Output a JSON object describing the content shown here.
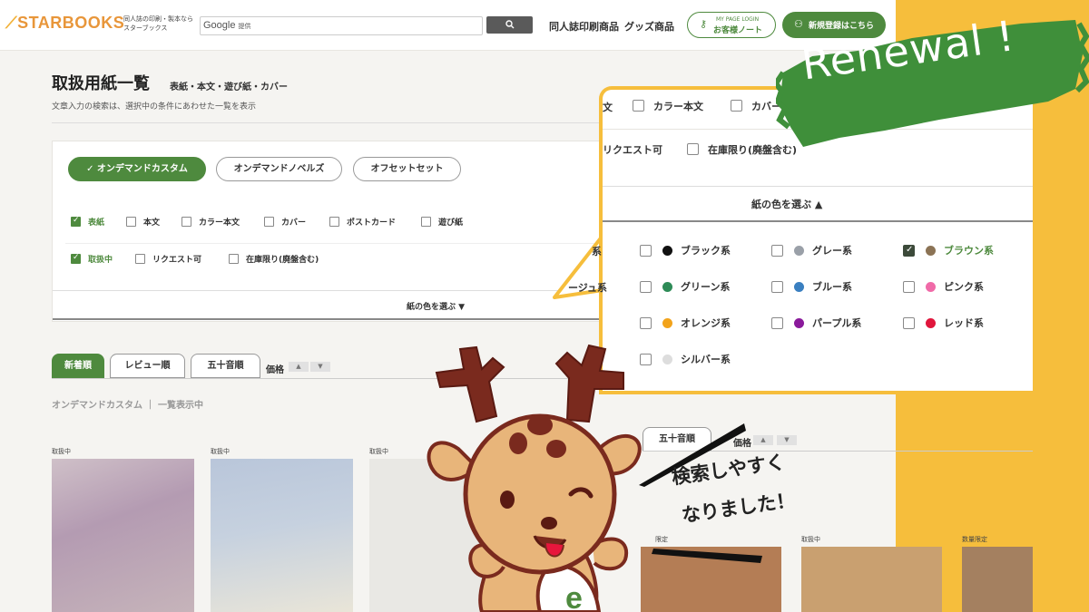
{
  "header": {
    "logo": "STARBOOKS",
    "logo_sub": "同人誌の印刷・製本なら スターブックス",
    "search_placeholder": "Google 提供",
    "search_prefix": "Google",
    "search_suffix": "提供",
    "nav": [
      "同人誌印刷商品",
      "グッズ商品"
    ],
    "mypage_small": "MY PAGE LOGIN",
    "mypage_label": "お客様ノート",
    "signup_label": "新規登録はこちら"
  },
  "page": {
    "title": "取扱用紙一覧",
    "subtitle": "表紙・本文・遊び紙・カバー",
    "description": "文章入力の検索は、選択中の条件にあわせた一覧を表示"
  },
  "filters": {
    "products": [
      {
        "label": "✓ オンデマンドカスタム",
        "active": true
      },
      {
        "label": "オンデマンドノベルズ",
        "active": false
      },
      {
        "label": "オフセットセット",
        "active": false
      }
    ],
    "usage": [
      {
        "label": "表紙",
        "checked": true
      },
      {
        "label": "本文",
        "checked": false
      },
      {
        "label": "カラー本文",
        "checked": false
      },
      {
        "label": "カバー",
        "checked": false
      },
      {
        "label": "ポストカード",
        "checked": false
      },
      {
        "label": "遊び紙",
        "checked": false
      }
    ],
    "status": [
      {
        "label": "取扱中",
        "checked": true
      },
      {
        "label": "リクエスト可",
        "checked": false
      },
      {
        "label": "在庫限り(廃盤含む)",
        "checked": false
      }
    ],
    "color_bar_label": "紙の色を選ぶ ▼"
  },
  "sort": {
    "tabs": [
      {
        "label": "新着順",
        "active": true
      },
      {
        "label": "レビュー順",
        "active": false
      },
      {
        "label": "五十音順",
        "active": false
      }
    ],
    "price_label": "価格",
    "price_up": "▲",
    "price_down": "▼"
  },
  "breadcrumb": "オンデマンドカスタム ｜ 一覧表示中",
  "papers": [
    {
      "status": "取扱中"
    },
    {
      "status": "取扱中"
    },
    {
      "status": "取扱中"
    }
  ],
  "zoom": {
    "row1_partial": "文",
    "row1": [
      {
        "label": "カラー本文",
        "checked": false
      },
      {
        "label": "カバー",
        "checked": false
      }
    ],
    "row2": [
      {
        "label": "リクエスト可",
        "checked": false
      },
      {
        "label": "在庫限り(廃盤含む)",
        "checked": false
      }
    ],
    "color_bar_label": "紙の色を選ぶ ▲",
    "left_partial_1": "系",
    "left_partial_2": "ージュ系",
    "colors": [
      {
        "label": "ブラック系",
        "dot": "#111111",
        "checked": false
      },
      {
        "label": "グレー系",
        "dot": "#9aa0a8",
        "checked": false
      },
      {
        "label": "ブラウン系",
        "dot": "#8b7355",
        "checked": true
      },
      {
        "label": "グリーン系",
        "dot": "#2e8b57",
        "checked": false
      },
      {
        "label": "ブルー系",
        "dot": "#3a7fc0",
        "checked": false
      },
      {
        "label": "ピンク系",
        "dot": "#f06aa8",
        "checked": false
      },
      {
        "label": "オレンジ系",
        "dot": "#f2a31b",
        "checked": false
      },
      {
        "label": "パープル系",
        "dot": "#8a1a9b",
        "checked": false
      },
      {
        "label": "レッド系",
        "dot": "#e0163c",
        "checked": false
      },
      {
        "label": "シルバー系",
        "dot": "#dddddd",
        "checked": false
      }
    ]
  },
  "lower_right": {
    "tab": "五十音順",
    "price_label": "価格",
    "status_labels": [
      "限定",
      "取扱中",
      "数量限定"
    ]
  },
  "renewal_text": "Renewal !",
  "speech": {
    "line1": "検索しやすく",
    "line2": "なりました！"
  },
  "colors": {
    "accent_green": "#4e8a3e",
    "yellow": "#f6be3c",
    "renewal_bg": "#3f8f3a"
  }
}
